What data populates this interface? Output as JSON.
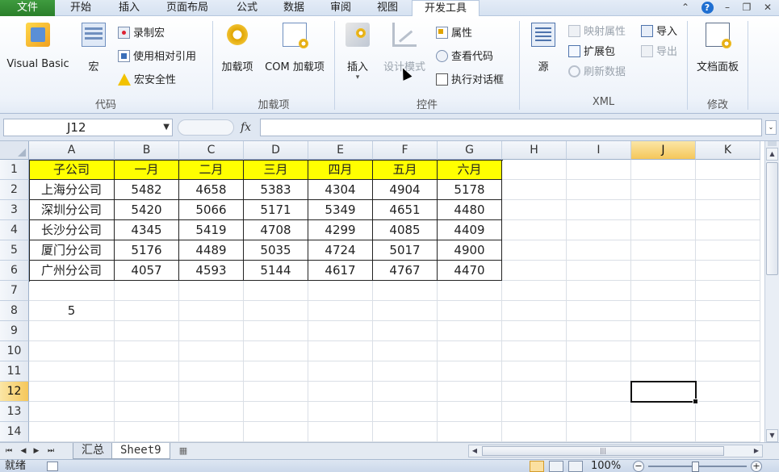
{
  "menu": {
    "tabs": [
      "文件",
      "开始",
      "插入",
      "页面布局",
      "公式",
      "数据",
      "审阅",
      "视图",
      "开发工具"
    ],
    "active_tab": "开发工具"
  },
  "ribbon": {
    "code": {
      "label": "代码",
      "visual_basic": "Visual Basic",
      "macros": "宏",
      "record_macro": "录制宏",
      "relative_ref": "使用相对引用",
      "macro_security": "宏安全性"
    },
    "addins": {
      "label": "加载项",
      "addins": "加载项",
      "com_addins": "COM 加载项"
    },
    "controls": {
      "label": "控件",
      "insert": "插入",
      "design_mode": "设计模式",
      "properties": "属性",
      "view_code": "查看代码",
      "run_dialog": "执行对话框"
    },
    "xml": {
      "label": "XML",
      "source": "源",
      "map_properties": "映射属性",
      "expansion_packs": "扩展包",
      "refresh_data": "刷新数据",
      "import": "导入",
      "export": "导出"
    },
    "modify": {
      "label": "修改",
      "doc_panel": "文档面板"
    }
  },
  "formula_bar": {
    "name_box": "J12",
    "fx_label": "fx",
    "formula": ""
  },
  "sheet": {
    "columns": [
      "A",
      "B",
      "C",
      "D",
      "E",
      "F",
      "G",
      "H",
      "I",
      "J",
      "K"
    ],
    "rows": [
      "1",
      "2",
      "3",
      "4",
      "5",
      "6",
      "7",
      "8",
      "9",
      "10",
      "11",
      "12",
      "13",
      "14"
    ],
    "selected_cell": "J12",
    "table": [
      [
        "子公司",
        "一月",
        "二月",
        "三月",
        "四月",
        "五月",
        "六月"
      ],
      [
        "上海分公司",
        "5482",
        "4658",
        "5383",
        "4304",
        "4904",
        "5178"
      ],
      [
        "深圳分公司",
        "5420",
        "5066",
        "5171",
        "5349",
        "4651",
        "4480"
      ],
      [
        "长沙分公司",
        "4345",
        "5419",
        "4708",
        "4299",
        "4085",
        "4409"
      ],
      [
        "厦门分公司",
        "5176",
        "4489",
        "5035",
        "4724",
        "5017",
        "4900"
      ],
      [
        "广州分公司",
        "4057",
        "4593",
        "5144",
        "4617",
        "4767",
        "4470"
      ]
    ],
    "a8_value": "5"
  },
  "sheet_tabs": [
    "汇总",
    "Sheet9"
  ],
  "active_sheet": "Sheet9",
  "status": {
    "ready": "就绪",
    "zoom": "100%"
  }
}
